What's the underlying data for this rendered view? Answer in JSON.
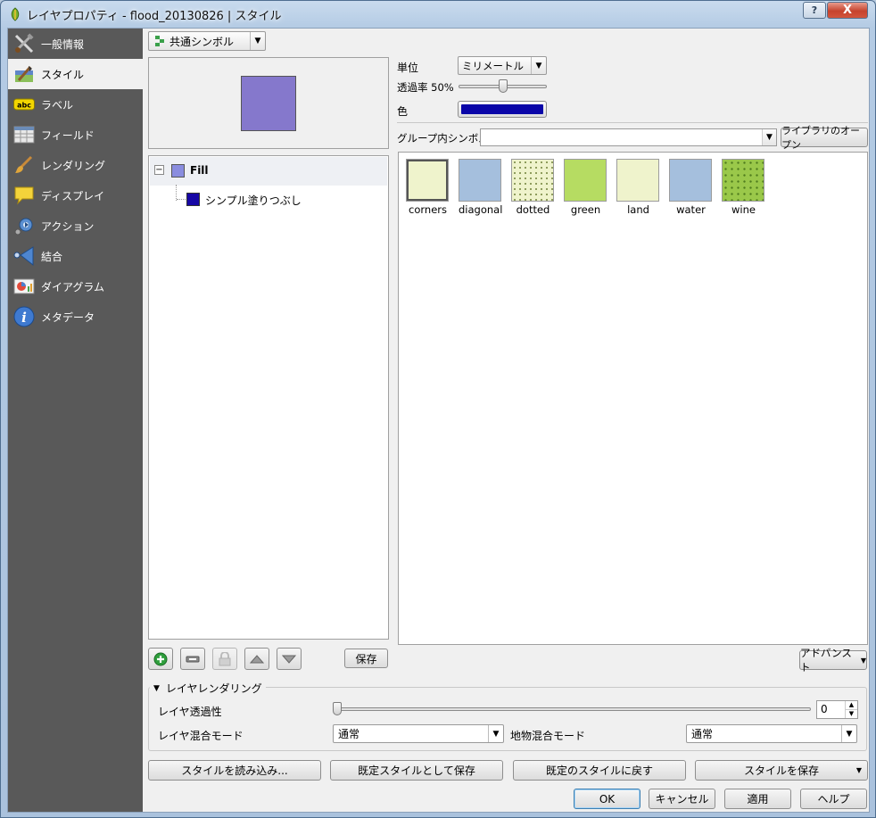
{
  "window": {
    "title": "レイヤプロパティ - flood_20130826 | スタイル",
    "help_label": "?",
    "close_label": "X"
  },
  "sidebar": {
    "items": [
      {
        "label": "一般情報",
        "icon": "tools-icon"
      },
      {
        "label": "スタイル",
        "icon": "paintbrush-icon"
      },
      {
        "label": "ラベル",
        "icon": "abc-label-icon"
      },
      {
        "label": "フィールド",
        "icon": "table-icon"
      },
      {
        "label": "レンダリング",
        "icon": "brush-icon"
      },
      {
        "label": "ディスプレイ",
        "icon": "speech-bubble-icon"
      },
      {
        "label": "アクション",
        "icon": "gear-action-icon"
      },
      {
        "label": "結合",
        "icon": "join-icon"
      },
      {
        "label": "ダイアグラム",
        "icon": "diagram-icon"
      },
      {
        "label": "メタデータ",
        "icon": "info-icon"
      }
    ],
    "active_index": 1
  },
  "renderer": {
    "type_label": "共通シンボル"
  },
  "preview": {
    "fill_color": "#8578cc"
  },
  "tree": {
    "root_label": "Fill",
    "root_color": "#8a8ddf",
    "child_label": "シンプル塗りつぶし",
    "child_color": "#1607a5"
  },
  "layer_buttons": {
    "save_label": "保存"
  },
  "symbol_props": {
    "unit_label": "単位",
    "unit_value": "ミリメートル",
    "transparency_label": "透過率 50%",
    "transparency_value": 0.5,
    "color_label": "色",
    "color_value": "#0a05a8"
  },
  "group": {
    "label": "グループ内シンボル",
    "value": "",
    "open_library_label": "ライブラリのオープン"
  },
  "symbols": [
    {
      "name": "corners",
      "color": "#eff3cc",
      "pattern": "corners"
    },
    {
      "name": "diagonal",
      "color": "#a5bfdd",
      "pattern": "none"
    },
    {
      "name": "dotted",
      "color": "#eff3cc",
      "pattern": "dots"
    },
    {
      "name": "green",
      "color": "#b6dc62",
      "pattern": "none"
    },
    {
      "name": "land",
      "color": "#eff3cc",
      "pattern": "none"
    },
    {
      "name": "water",
      "color": "#a5bfdd",
      "pattern": "none"
    },
    {
      "name": "wine",
      "color": "#9ac84a",
      "pattern": "wine"
    }
  ],
  "advanced_label": "アドバンスト",
  "layer_rendering": {
    "section_label": "レイヤレンダリング",
    "transparency_label": "レイヤ透過性",
    "transparency_value": "0",
    "blend_label": "レイヤ混合モード",
    "blend_value": "通常",
    "feature_blend_label": "地物混合モード",
    "feature_blend_value": "通常"
  },
  "style_buttons": {
    "load": "スタイルを読み込み...",
    "save_default": "既定スタイルとして保存",
    "restore_default": "既定のスタイルに戻す",
    "save_style": "スタイルを保存"
  },
  "dialog_buttons": {
    "ok": "OK",
    "cancel": "キャンセル",
    "apply": "適用",
    "help": "ヘルプ"
  }
}
